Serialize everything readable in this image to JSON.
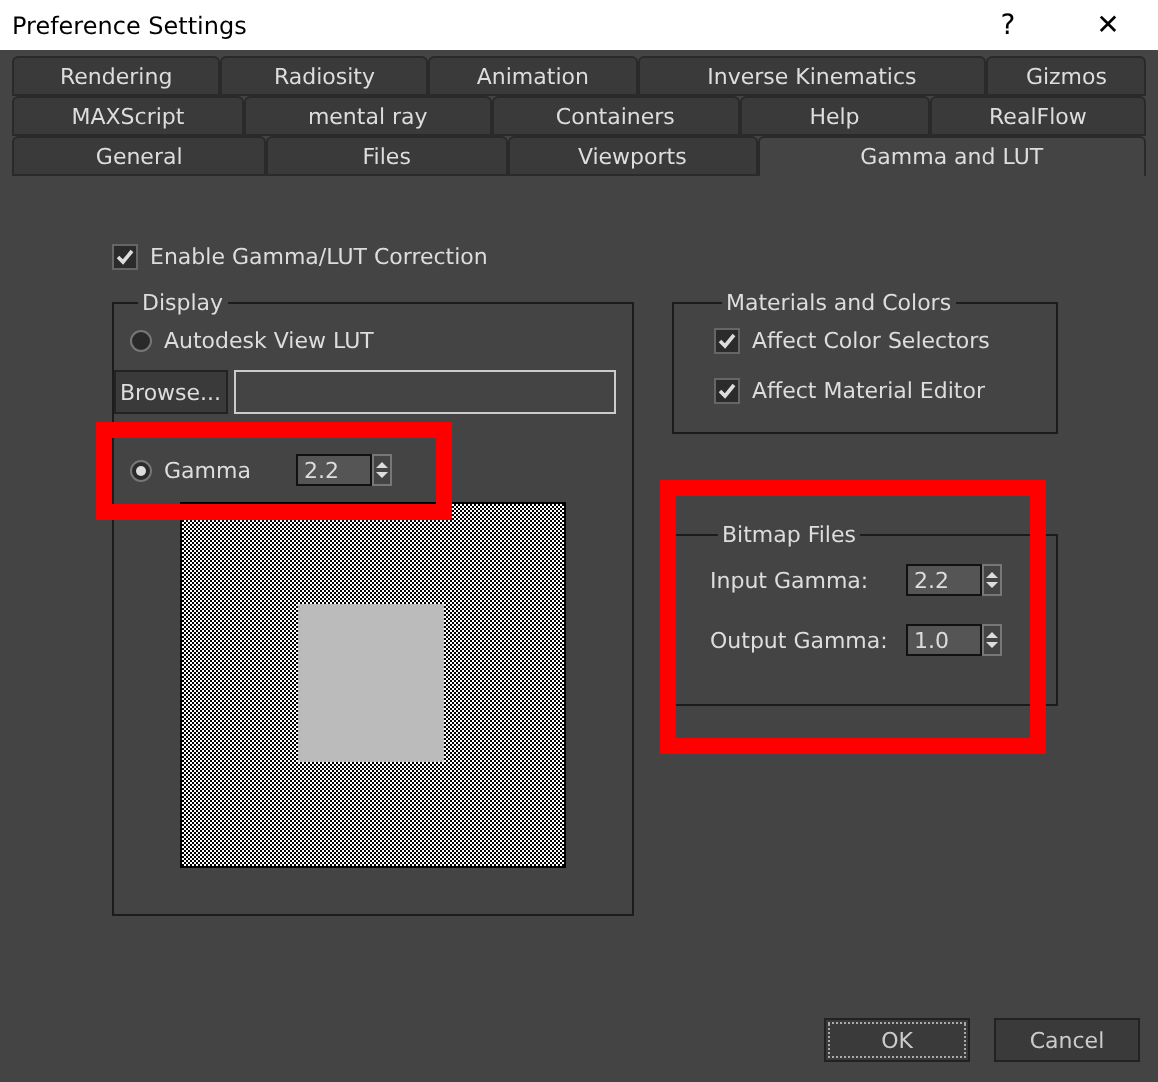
{
  "window": {
    "title": "Preference Settings",
    "help": "?",
    "close": "✕"
  },
  "tab_rows": [
    [
      {
        "label": "Rendering",
        "selected": false
      },
      {
        "label": "Radiosity",
        "selected": false
      },
      {
        "label": "Animation",
        "selected": false
      },
      {
        "label": "Inverse Kinematics",
        "selected": false
      },
      {
        "label": "Gizmos",
        "selected": false
      }
    ],
    [
      {
        "label": "MAXScript",
        "selected": false
      },
      {
        "label": "mental ray",
        "selected": false
      },
      {
        "label": "Containers",
        "selected": false
      },
      {
        "label": "Help",
        "selected": false
      },
      {
        "label": "RealFlow",
        "selected": false
      }
    ],
    [
      {
        "label": "General",
        "selected": false
      },
      {
        "label": "Files",
        "selected": false
      },
      {
        "label": "Viewports",
        "selected": false
      },
      {
        "label": "Gamma and LUT",
        "selected": true
      }
    ]
  ],
  "enable": {
    "label": "Enable Gamma/LUT Correction",
    "checked": true
  },
  "display": {
    "title": "Display",
    "lut": {
      "label": "Autodesk View LUT",
      "selected": false
    },
    "browse": "Browse...",
    "gamma": {
      "label": "Gamma",
      "selected": true,
      "value": "2.2"
    }
  },
  "materials": {
    "title": "Materials and Colors",
    "options": [
      {
        "label": "Affect Color Selectors",
        "checked": true
      },
      {
        "label": "Affect Material Editor",
        "checked": true
      }
    ]
  },
  "bitmap": {
    "title": "Bitmap Files",
    "fields": [
      {
        "label": "Input Gamma:",
        "value": "2.2"
      },
      {
        "label": "Output Gamma:",
        "value": "1.0"
      }
    ]
  },
  "buttons": [
    "OK",
    "Cancel"
  ]
}
